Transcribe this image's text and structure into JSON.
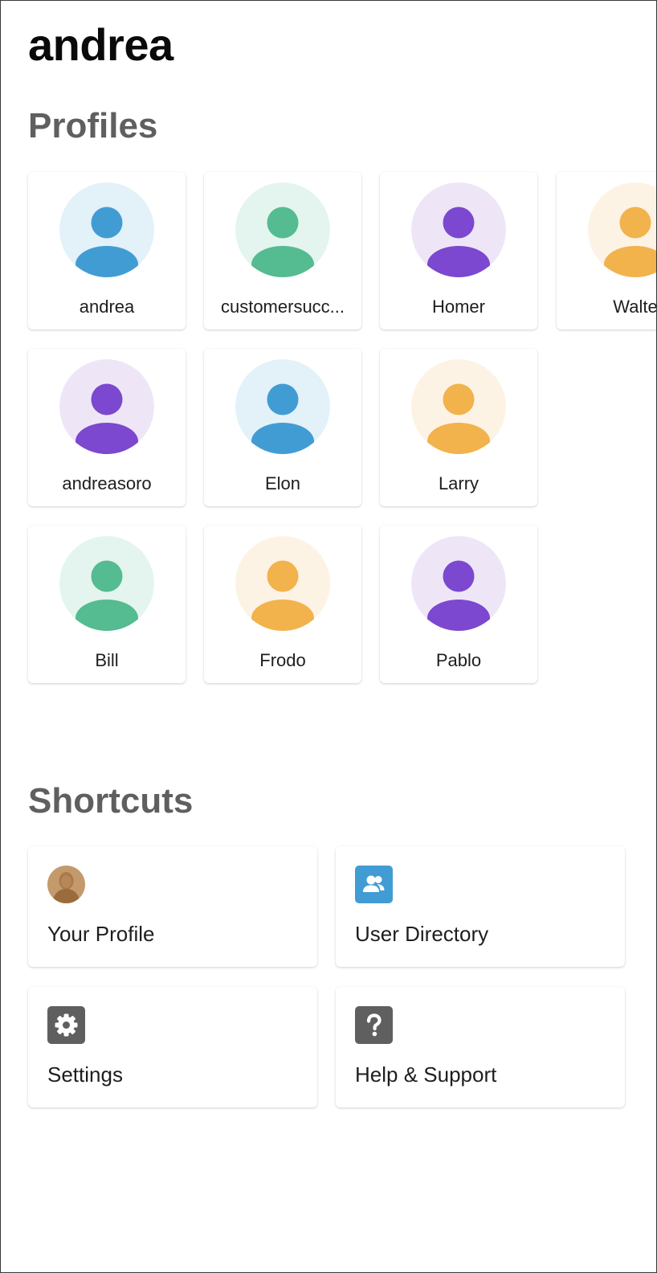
{
  "header": {
    "title": "andrea"
  },
  "profiles": {
    "title": "Profiles",
    "items": [
      {
        "name": "andrea",
        "bg": "#e3f1f9",
        "fg": "#429cd4"
      },
      {
        "name": "customersucc...",
        "bg": "#e3f5ee",
        "fg": "#55bb91"
      },
      {
        "name": "Homer",
        "bg": "#eee6f7",
        "fg": "#7b48cf"
      },
      {
        "name": "Walte",
        "bg": "#fdf3e5",
        "fg": "#f2b24c"
      },
      {
        "name": "andreasoro",
        "bg": "#eee6f7",
        "fg": "#7b48cf"
      },
      {
        "name": "Elon",
        "bg": "#e3f1f9",
        "fg": "#429cd4"
      },
      {
        "name": "Larry",
        "bg": "#fdf3e5",
        "fg": "#f2b24c"
      },
      {
        "name": "Bill",
        "bg": "#e3f5ee",
        "fg": "#55bb91"
      },
      {
        "name": "Frodo",
        "bg": "#fdf3e5",
        "fg": "#f2b24c"
      },
      {
        "name": "Pablo",
        "bg": "#eee6f7",
        "fg": "#7b48cf"
      }
    ]
  },
  "shortcuts": {
    "title": "Shortcuts",
    "items": [
      {
        "label": "Your Profile",
        "icon": "user-photo-avatar"
      },
      {
        "label": "User Directory",
        "icon": "users-icon",
        "color": "#429cd4"
      },
      {
        "label": "Settings",
        "icon": "gear-icon",
        "color": "#5f5f5f"
      },
      {
        "label": "Help & Support",
        "icon": "question-icon",
        "color": "#5f5f5f"
      }
    ]
  }
}
